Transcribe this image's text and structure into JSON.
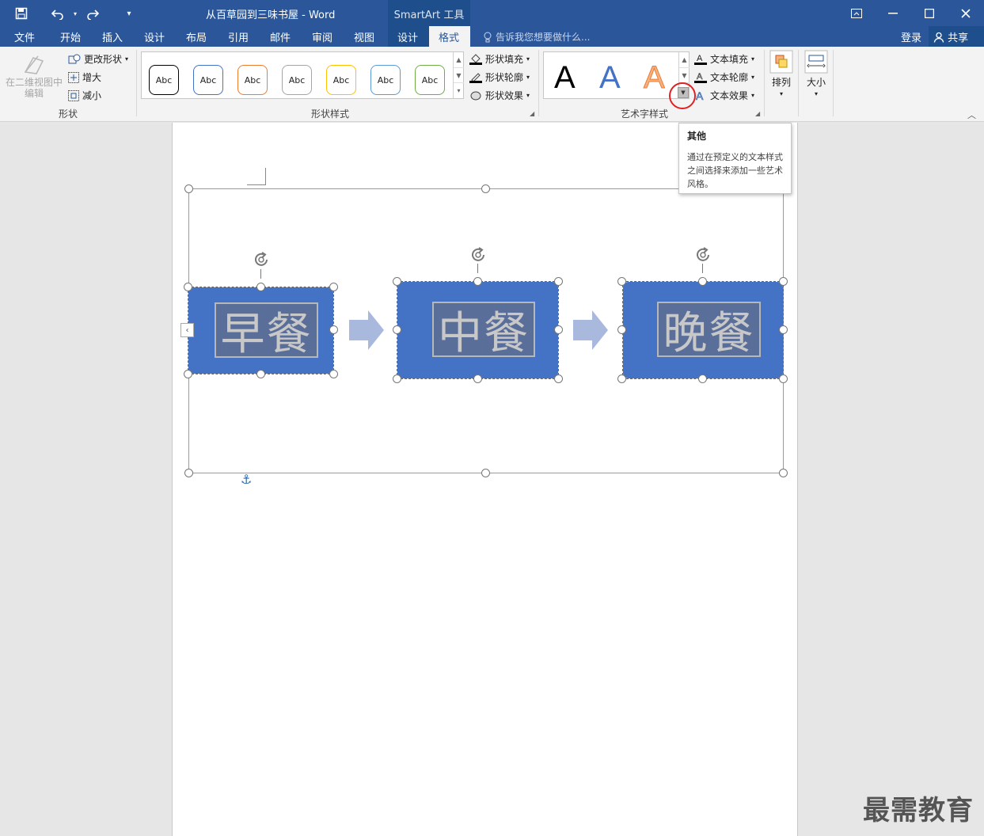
{
  "window": {
    "title": "从百草园到三味书屋 - Word",
    "context_band": "SmartArt 工具"
  },
  "tabs": {
    "file": "文件",
    "home": "开始",
    "insert": "插入",
    "design": "设计",
    "layout": "布局",
    "references": "引用",
    "mailings": "邮件",
    "review": "审阅",
    "view": "视图",
    "ctx_design": "设计",
    "ctx_format": "格式"
  },
  "tellme": "告诉我您想要做什么...",
  "account": {
    "login": "登录",
    "share": "共享"
  },
  "ribbon": {
    "shapes_group": {
      "edit_2d": "在二维视图中编辑",
      "change_shape": "更改形状",
      "larger": "增大",
      "smaller": "减小",
      "label": "形状"
    },
    "shape_styles": {
      "thumb_text": "Abc",
      "colors": [
        "#000000",
        "#4472c4",
        "#ed7d31",
        "#a5a5a5",
        "#ffc000",
        "#5b9bd5",
        "#70ad47"
      ],
      "fill": "形状填充",
      "outline": "形状轮廓",
      "effects": "形状效果",
      "label": "形状样式"
    },
    "wordart": {
      "letter": "A",
      "text_fill": "文本填充",
      "text_outline": "文本轮廓",
      "text_effects": "文本效果",
      "label": "艺术字样式"
    },
    "arrange": "排列",
    "size": "大小"
  },
  "tooltip": {
    "title": "其他",
    "body": "通过在预定义的文本样式之间选择来添加一些艺术风格。"
  },
  "smartart": {
    "nodes": [
      "早餐",
      "中餐",
      "晚餐"
    ],
    "fill_color": "#4472c4",
    "arrow_color": "#a9b9de"
  },
  "watermark": "最需教育"
}
